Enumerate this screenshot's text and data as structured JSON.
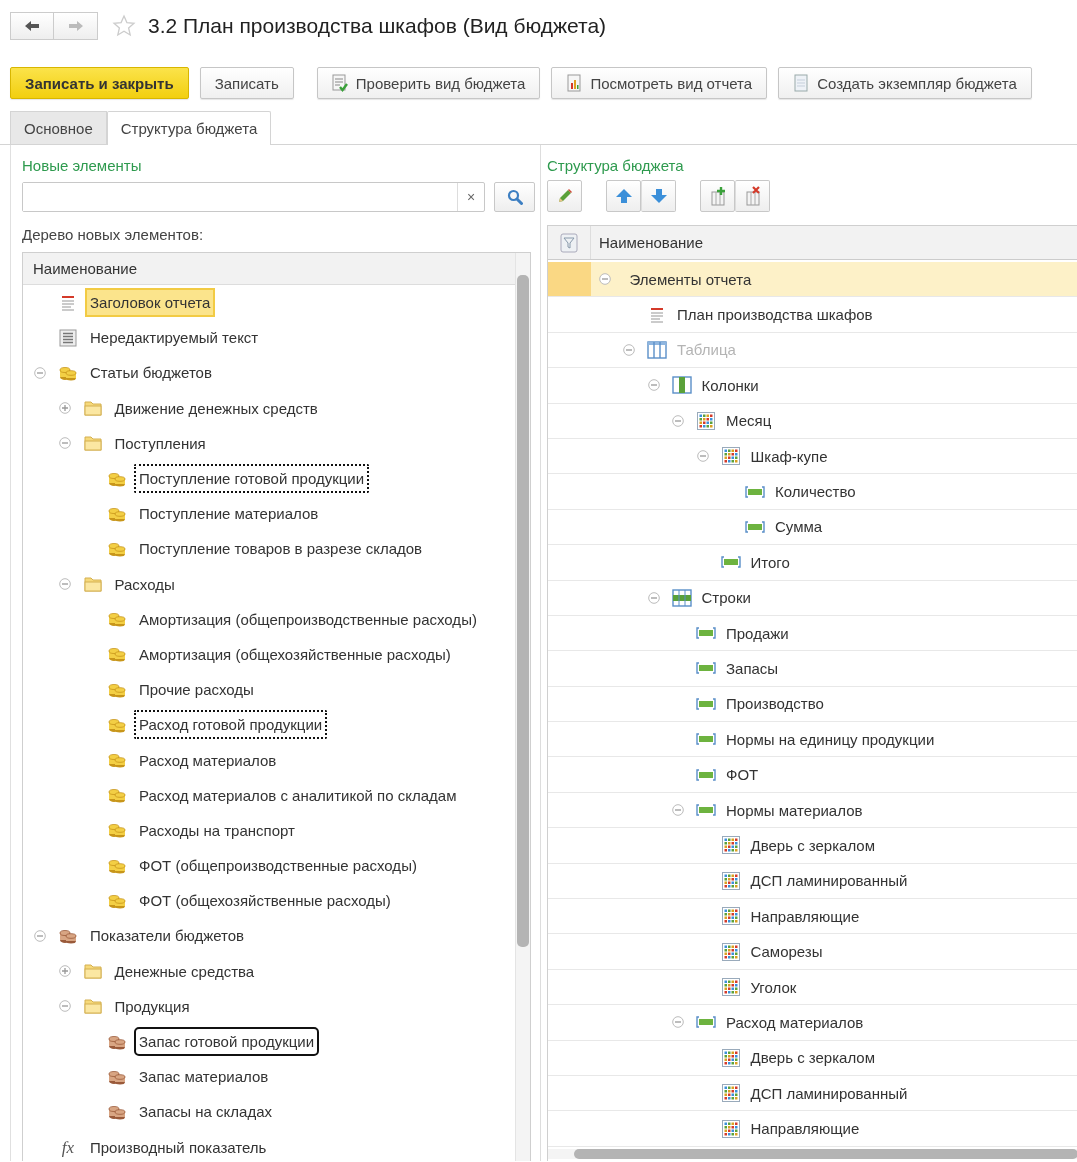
{
  "window": {
    "title": "3.2 План производства шкафов (Вид бюджета)"
  },
  "toolbar": [
    {
      "label": "Записать и закрыть",
      "kind": "primary"
    },
    {
      "label": "Записать",
      "kind": "plain"
    },
    {
      "label": "Проверить вид бюджета",
      "kind": "check"
    },
    {
      "label": "Посмотреть вид отчета",
      "kind": "report"
    },
    {
      "label": "Создать экземпляр бюджета",
      "kind": "create"
    }
  ],
  "tabs": [
    {
      "label": "Основное",
      "selected": false
    },
    {
      "label": "Структура бюджета",
      "selected": true
    }
  ],
  "new_elements": {
    "title": "Новые элементы",
    "clear_glyph": "×",
    "tree_label": "Дерево новых элементов:",
    "tree": {
      "column": "Наименование",
      "items": [
        {
          "label": "Заголовок отчета",
          "kind": "header",
          "selected": true
        },
        {
          "label": "Нередактируемый текст",
          "kind": "text",
          "selected": false
        },
        {
          "label": "Статьи бюджетов",
          "kind": "coins",
          "selected": false,
          "expanded": true,
          "children": [
            {
              "label": "Движение денежных средств",
              "kind": "folder",
              "selected": false,
              "expanded": false
            },
            {
              "label": "Поступления",
              "kind": "folder",
              "selected": false,
              "expanded": true,
              "children": [
                {
                  "label": "Поступление готовой продукции",
                  "kind": "coins",
                  "selected": false,
                  "dotted_frame": true
                },
                {
                  "label": "Поступление материалов",
                  "kind": "coins",
                  "selected": false
                },
                {
                  "label": "Поступление товаров в разрезе складов",
                  "kind": "coins",
                  "selected": false
                }
              ]
            },
            {
              "label": "Расходы",
              "kind": "folder",
              "selected": false,
              "expanded": true,
              "children": [
                {
                  "label": "Амортизация (общепроизводственные расходы)",
                  "kind": "coins",
                  "selected": false
                },
                {
                  "label": "Амортизация (общехозяйственные расходы)",
                  "kind": "coins",
                  "selected": false
                },
                {
                  "label": "Прочие расходы",
                  "kind": "coins",
                  "selected": false
                },
                {
                  "label": "Расход готовой продукции",
                  "kind": "coins",
                  "selected": false,
                  "dotted_frame": true
                },
                {
                  "label": "Расход материалов",
                  "kind": "coins",
                  "selected": false
                },
                {
                  "label": "Расход материалов с аналитикой по складам",
                  "kind": "coins",
                  "selected": false
                },
                {
                  "label": "Расходы на транспорт",
                  "kind": "coins",
                  "selected": false
                },
                {
                  "label": "ФОТ (общепроизводственные расходы)",
                  "kind": "coins",
                  "selected": false
                },
                {
                  "label": "ФОТ (общехозяйственные расходы)",
                  "kind": "coins",
                  "selected": false
                }
              ]
            }
          ]
        },
        {
          "label": "Показатели бюджетов",
          "kind": "indicator",
          "selected": false,
          "expanded": true,
          "children": [
            {
              "label": "Денежные средства",
              "kind": "folder",
              "selected": false,
              "expanded": false
            },
            {
              "label": "Продукция",
              "kind": "folder",
              "selected": false,
              "expanded": true,
              "children": [
                {
                  "label": "Запас готовой продукции",
                  "kind": "indicator",
                  "selected": false,
                  "solid_frame": true
                },
                {
                  "label": "Запас материалов",
                  "kind": "indicator",
                  "selected": false
                },
                {
                  "label": "Запасы на складах",
                  "kind": "indicator",
                  "selected": false
                }
              ]
            }
          ]
        },
        {
          "label": "Производный показатель",
          "kind": "formula",
          "glyph": "fx",
          "selected": false
        }
      ]
    }
  },
  "structure": {
    "title": "Структура бюджета",
    "tree": {
      "column": "Наименование",
      "items": [
        {
          "label": "Элементы отчета",
          "kind": "group",
          "selected": true,
          "disabled": false,
          "expanded": true,
          "children": [
            {
              "label": "План производства шкафов",
              "kind": "header",
              "selected": false,
              "disabled": false
            },
            {
              "label": "Таблица",
              "kind": "table",
              "selected": false,
              "disabled": true,
              "expanded": true,
              "children": [
                {
                  "label": "Колонки",
                  "kind": "columns",
                  "selected": false,
                  "disabled": false,
                  "expanded": true,
                  "children": [
                    {
                      "label": "Месяц",
                      "kind": "grid",
                      "selected": false,
                      "disabled": false,
                      "expanded": true,
                      "children": [
                        {
                          "label": "Шкаф-купе",
                          "kind": "grid",
                          "selected": false,
                          "disabled": false,
                          "expanded": true,
                          "children": [
                            {
                              "label": "Количество",
                              "kind": "row",
                              "selected": false,
                              "disabled": false
                            },
                            {
                              "label": "Сумма",
                              "kind": "row",
                              "selected": false,
                              "disabled": false
                            }
                          ]
                        },
                        {
                          "label": "Итого",
                          "kind": "row",
                          "selected": false,
                          "disabled": false
                        }
                      ]
                    }
                  ]
                },
                {
                  "label": "Строки",
                  "kind": "rows",
                  "selected": false,
                  "disabled": false,
                  "expanded": true,
                  "children": [
                    {
                      "label": "Продажи",
                      "kind": "row",
                      "selected": false,
                      "disabled": false
                    },
                    {
                      "label": "Запасы",
                      "kind": "row",
                      "selected": false,
                      "disabled": false
                    },
                    {
                      "label": "Производство",
                      "kind": "row",
                      "selected": false,
                      "disabled": false
                    },
                    {
                      "label": "Нормы на единицу продукции",
                      "kind": "row",
                      "selected": false,
                      "disabled": false
                    },
                    {
                      "label": "ФОТ",
                      "kind": "row",
                      "selected": false,
                      "disabled": false
                    },
                    {
                      "label": "Нормы материалов",
                      "kind": "row",
                      "selected": false,
                      "disabled": false,
                      "expanded": true,
                      "children": [
                        {
                          "label": "Дверь с зеркалом",
                          "kind": "grid",
                          "selected": false,
                          "disabled": false
                        },
                        {
                          "label": "ДСП ламинированный",
                          "kind": "grid",
                          "selected": false,
                          "disabled": false
                        },
                        {
                          "label": "Направляющие",
                          "kind": "grid",
                          "selected": false,
                          "disabled": false
                        },
                        {
                          "label": "Саморезы",
                          "kind": "grid",
                          "selected": false,
                          "disabled": false
                        },
                        {
                          "label": "Уголок",
                          "kind": "grid",
                          "selected": false,
                          "disabled": false
                        }
                      ]
                    },
                    {
                      "label": "Расход материалов",
                      "kind": "row",
                      "selected": false,
                      "disabled": false,
                      "expanded": true,
                      "children": [
                        {
                          "label": "Дверь с зеркалом",
                          "kind": "grid",
                          "selected": false,
                          "disabled": false
                        },
                        {
                          "label": "ДСП ламинированный",
                          "kind": "grid",
                          "selected": false,
                          "disabled": false
                        },
                        {
                          "label": "Направляющие",
                          "kind": "grid",
                          "selected": false,
                          "disabled": false
                        }
                      ]
                    }
                  ]
                }
              ]
            }
          ]
        }
      ]
    }
  }
}
